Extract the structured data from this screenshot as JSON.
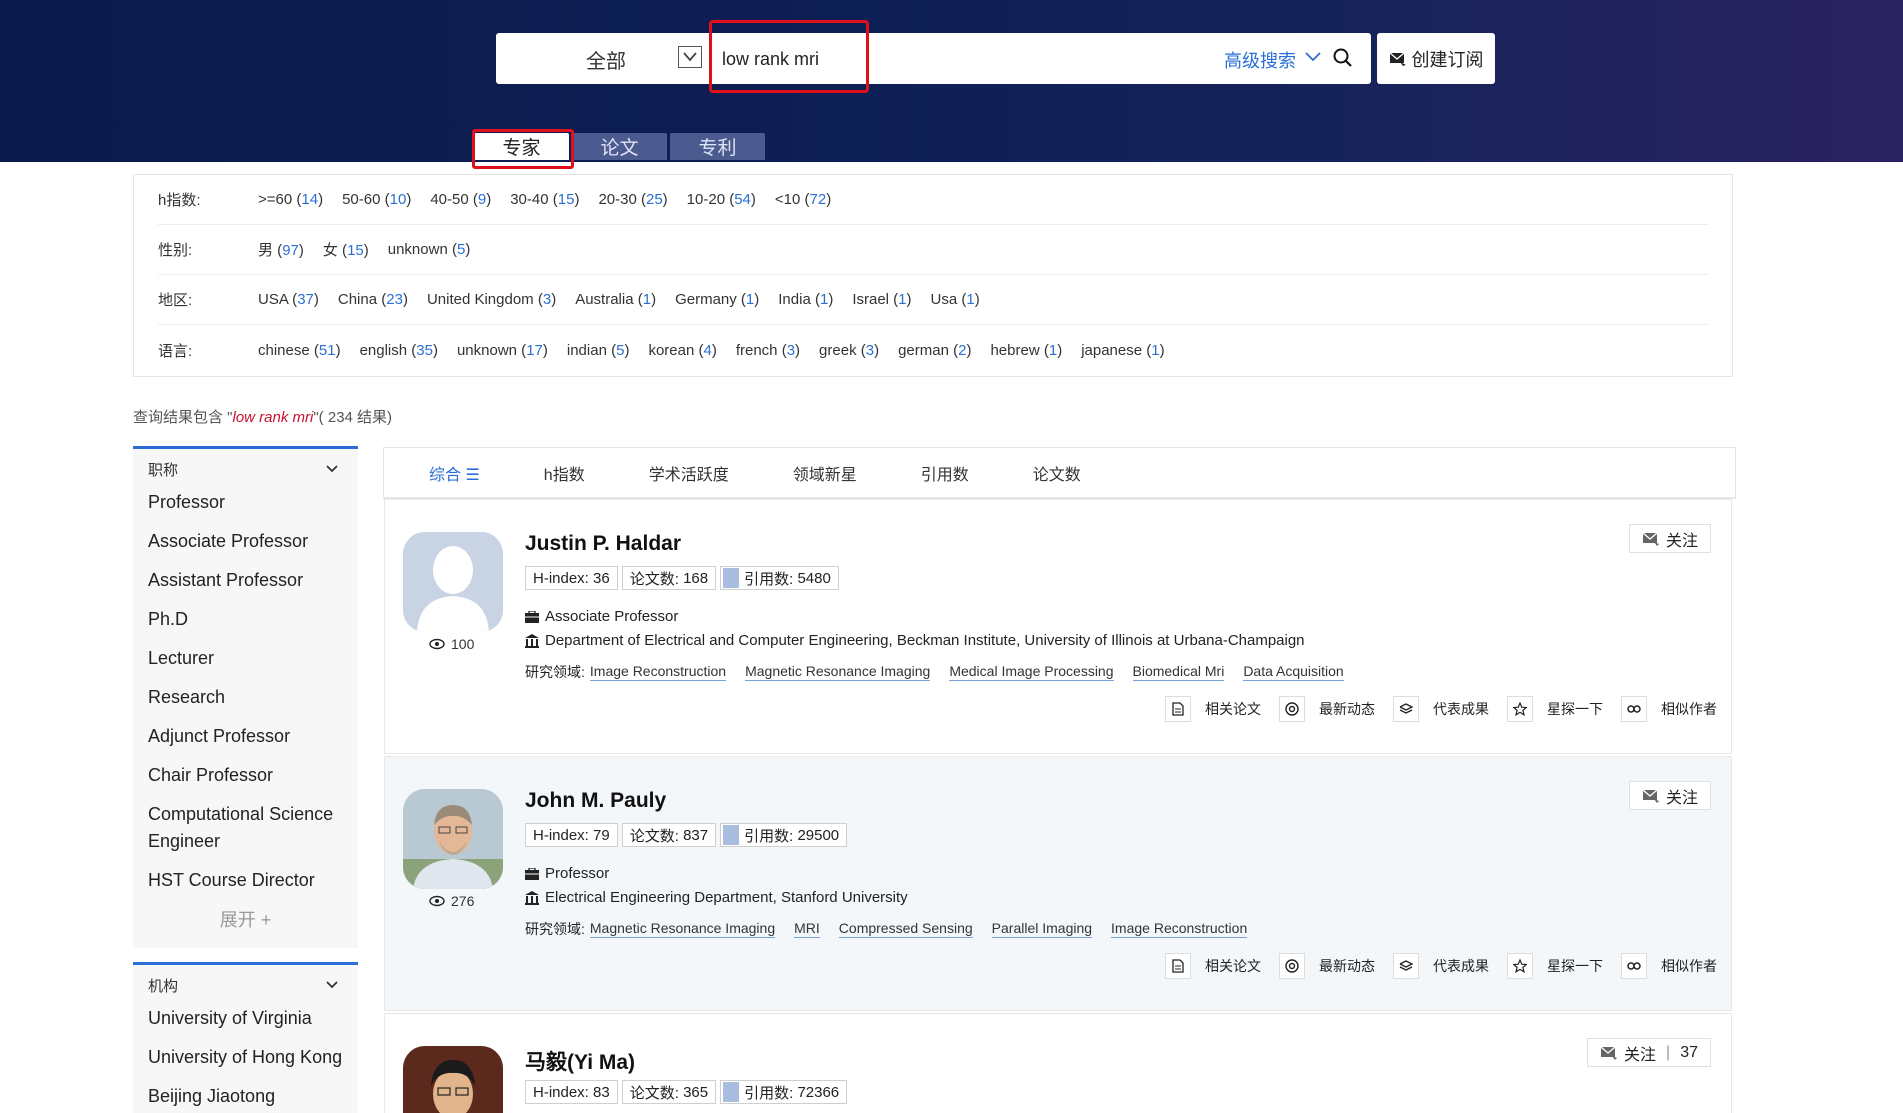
{
  "search": {
    "scope": "全部",
    "query": "low rank mri",
    "advanced": "高级搜索",
    "subscribe": "创建订阅"
  },
  "tabs": [
    "专家",
    "论文",
    "专利"
  ],
  "filters": {
    "hindex": {
      "label": "h指数:",
      "options": [
        {
          "name": ">=60",
          "count": "14"
        },
        {
          "name": "50-60",
          "count": "10"
        },
        {
          "name": "40-50",
          "count": "9"
        },
        {
          "name": "30-40",
          "count": "15"
        },
        {
          "name": "20-30",
          "count": "25"
        },
        {
          "name": "10-20",
          "count": "54"
        },
        {
          "name": "<10",
          "count": "72"
        }
      ]
    },
    "gender": {
      "label": "性别:",
      "options": [
        {
          "name": "男",
          "count": "97"
        },
        {
          "name": "女",
          "count": "15"
        },
        {
          "name": "unknown",
          "count": "5"
        }
      ]
    },
    "region": {
      "label": "地区:",
      "options": [
        {
          "name": "USA",
          "count": "37"
        },
        {
          "name": "China",
          "count": "23"
        },
        {
          "name": "United Kingdom",
          "count": "3"
        },
        {
          "name": "Australia",
          "count": "1"
        },
        {
          "name": "Germany",
          "count": "1"
        },
        {
          "name": "India",
          "count": "1"
        },
        {
          "name": "Israel",
          "count": "1"
        },
        {
          "name": "Usa",
          "count": "1"
        }
      ]
    },
    "language": {
      "label": "语言:",
      "options": [
        {
          "name": "chinese",
          "count": "51"
        },
        {
          "name": "english",
          "count": "35"
        },
        {
          "name": "unknown",
          "count": "17"
        },
        {
          "name": "indian",
          "count": "5"
        },
        {
          "name": "korean",
          "count": "4"
        },
        {
          "name": "french",
          "count": "3"
        },
        {
          "name": "greek",
          "count": "3"
        },
        {
          "name": "german",
          "count": "2"
        },
        {
          "name": "hebrew",
          "count": "1"
        },
        {
          "name": "japanese",
          "count": "1"
        }
      ]
    }
  },
  "summary": {
    "prefix": "查询结果包含 \"",
    "query": "low rank mri",
    "suffix": "\"( 234 结果)"
  },
  "facets": {
    "title": {
      "label": "职称",
      "items": [
        "Professor",
        "Associate Professor",
        "Assistant Professor",
        "Ph.D",
        "Lecturer",
        "Research",
        "Adjunct Professor",
        "Chair Professor",
        "Computational Science Engineer",
        "HST Course Director"
      ],
      "expand": "展开 +"
    },
    "org": {
      "label": "机构",
      "items": [
        "University of Virginia",
        "University of Hong Kong",
        "Beijing Jiaotong"
      ]
    }
  },
  "sort": [
    "综合 ☰",
    "h指数",
    "学术活跃度",
    "领域新星",
    "引用数",
    "论文数"
  ],
  "labels": {
    "hindex": "H-index:",
    "papers": "论文数:",
    "citations": "引用数:",
    "fields": "研究领域:",
    "follow": "关注",
    "actions": [
      "相关论文",
      "最新动态",
      "代表成果",
      "星探一下",
      "相似作者"
    ]
  },
  "scholars": [
    {
      "name": "Justin P. Haldar",
      "hindex": "36",
      "papers": "168",
      "citations": "5480",
      "title": "Associate Professor",
      "affiliation": "Department of Electrical and Computer Engineering, Beckman Institute, University of Illinois at Urbana-Champaign",
      "fields": [
        "Image Reconstruction",
        "Magnetic Resonance Imaging",
        "Medical Image Processing",
        "Biomedical Mri",
        "Data Acquisition"
      ],
      "views": "100",
      "followers": ""
    },
    {
      "name": "John M. Pauly",
      "hindex": "79",
      "papers": "837",
      "citations": "29500",
      "title": "Professor",
      "affiliation": "Electrical Engineering Department, Stanford University",
      "fields": [
        "Magnetic Resonance Imaging",
        "MRI",
        "Compressed Sensing",
        "Parallel Imaging",
        "Image Reconstruction"
      ],
      "views": "276",
      "followers": ""
    },
    {
      "name": "马毅(Yi Ma)",
      "hindex": "83",
      "papers": "365",
      "citations": "72366",
      "title": "",
      "affiliation": "",
      "fields": [],
      "views": "",
      "followers": "37"
    }
  ],
  "colors": {
    "header": "#0e1f55",
    "accent": "#2a6fd6",
    "highlight": "#e0101a"
  }
}
